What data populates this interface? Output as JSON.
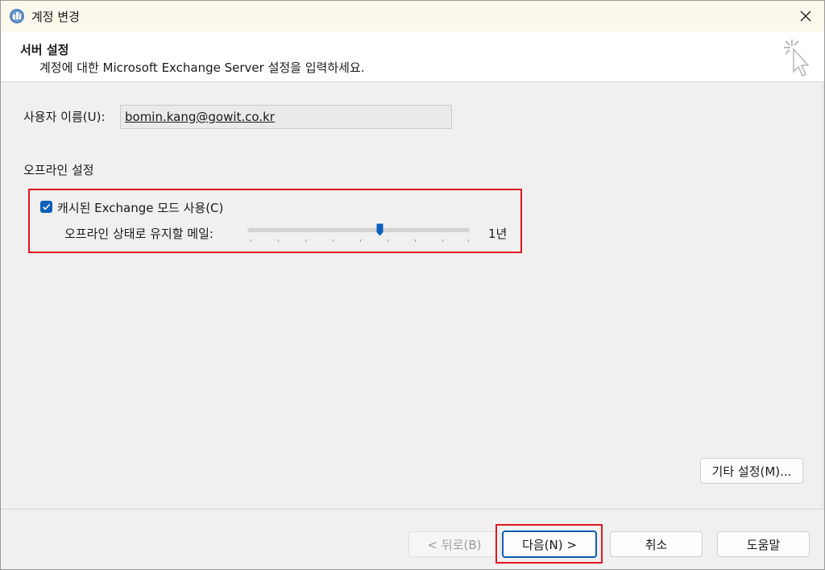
{
  "window": {
    "title": "계정 변경",
    "icons": {
      "app": "outlook-account-icon",
      "close": "close-icon"
    }
  },
  "header": {
    "title": "서버 설정",
    "subtitle": "계정에 대한 Microsoft Exchange Server 설정을 입력하세요.",
    "graphic": "cursor-sparkle-icon"
  },
  "user": {
    "label": "사용자 이름(U):",
    "value": "bomin.kang@gowit.co.kr"
  },
  "offline": {
    "section_title": "오프라인 설정",
    "cached_mode_label": "캐시된 Exchange 모드 사용(C)",
    "cached_mode_checked": true,
    "mail_to_keep_label": "오프라인 상태로 유지할 메일:",
    "mail_to_keep_value": "1년",
    "slider_position_fraction": 0.6
  },
  "buttons": {
    "more_settings": "기타 설정(M)...",
    "back": "< 뒤로(B)",
    "next": "다음(N) >",
    "cancel": "취소",
    "help": "도움말"
  },
  "colors": {
    "accent": "#0a5fbd",
    "highlight": "#e0191f",
    "title_bar": "#fbf9ec",
    "body_bg": "#f0f0f0"
  }
}
